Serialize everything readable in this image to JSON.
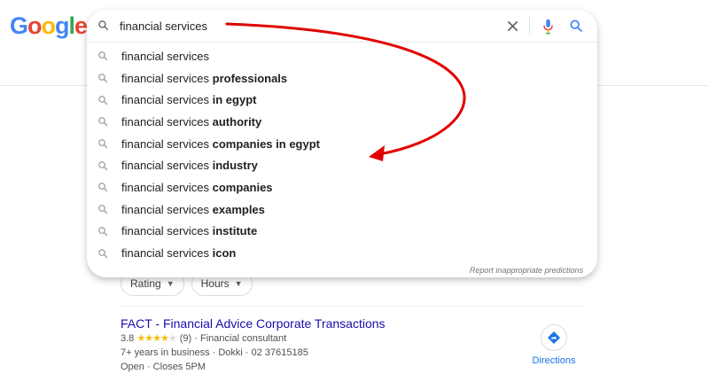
{
  "logo": {
    "text": "Google"
  },
  "search": {
    "query": "financial services",
    "placeholder": "",
    "suggestions": [
      {
        "base": "financial services",
        "extra": ""
      },
      {
        "base": "financial services",
        "extra": "professionals"
      },
      {
        "base": "financial services",
        "extra": "in egypt"
      },
      {
        "base": "financial services",
        "extra": "authority"
      },
      {
        "base": "financial services",
        "extra": "companies in egypt"
      },
      {
        "base": "financial services",
        "extra": "industry"
      },
      {
        "base": "financial services",
        "extra": "companies"
      },
      {
        "base": "financial services",
        "extra": "examples"
      },
      {
        "base": "financial services",
        "extra": "institute"
      },
      {
        "base": "financial services",
        "extra": "icon"
      }
    ],
    "report_link": "Report inappropriate predictions"
  },
  "filters": [
    {
      "label": "Rating"
    },
    {
      "label": "Hours"
    }
  ],
  "result": {
    "name": "FACT - Financial Advice Corporate Transactions",
    "rating": "3.8",
    "stars_filled": "★★★★",
    "stars_empty": "★",
    "review_count": "(9)",
    "category": "Financial consultant",
    "info": "7+ years in business · Dokki · 02 37615185",
    "hours": "Open · Closes 5PM",
    "directions_label": "Directions"
  },
  "colors": {
    "google_blue": "#4285f4",
    "google_red": "#ea4335",
    "google_yellow": "#fbbc05",
    "google_green": "#34a853",
    "annotation_arrow": "#e10000",
    "link_blue": "#1a0dab"
  }
}
